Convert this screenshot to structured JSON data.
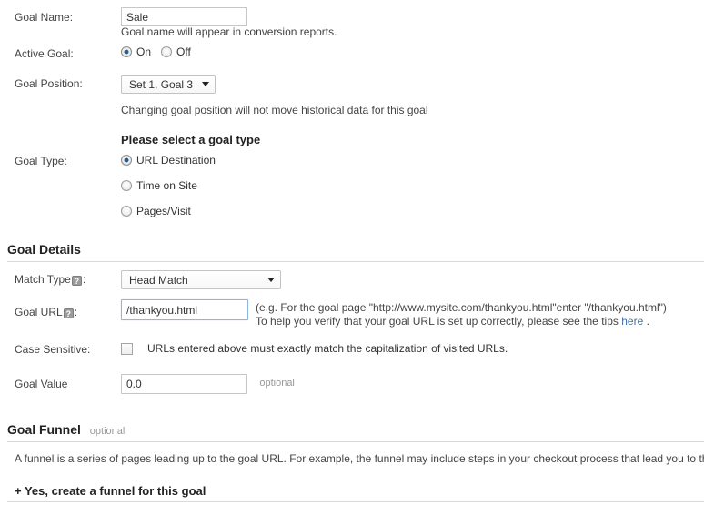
{
  "form": {
    "goal_name": {
      "label": "Goal Name:",
      "value": "Sale",
      "placeholder": "",
      "note": "Goal name will appear in conversion reports."
    },
    "active_goal": {
      "label": "Active Goal:",
      "on_label": "On",
      "off_label": "Off",
      "selected": "On"
    },
    "goal_position": {
      "label": "Goal Position:",
      "value": "Set 1, Goal 3",
      "note": "Changing goal position will not move historical data for this goal"
    },
    "goal_type": {
      "label": "Goal Type:",
      "heading": "Please select a goal type",
      "options": [
        {
          "label": "URL Destination",
          "selected": true
        },
        {
          "label": "Time on Site",
          "selected": false
        },
        {
          "label": "Pages/Visit",
          "selected": false
        }
      ]
    }
  },
  "goal_details": {
    "heading": "Goal Details",
    "match_type": {
      "label_text": "Match Type",
      "label_suffix": ":",
      "help_icon": "question-mark-icon",
      "help_glyph": "?",
      "value": "Head Match"
    },
    "goal_url": {
      "label_text": "Goal URL",
      "label_suffix": ":",
      "help_icon": "question-mark-icon",
      "help_glyph": "?",
      "value": "/thankyou.html",
      "placeholder": "",
      "hint_line1": "(e.g. For the goal page \"http://www.mysite.com/thankyou.html\"enter \"/thankyou.html\")",
      "hint_line2_before": "To help you verify that your goal URL is set up correctly, please see the tips",
      "hint_link": "here",
      "hint_line2_after": "."
    },
    "case_sensitive": {
      "label": "Case Sensitive:",
      "checked": false,
      "description": "URLs entered above must exactly match the capitalization of visited URLs."
    },
    "goal_value": {
      "label": "Goal Value",
      "value": "0.0",
      "placeholder": "",
      "optional_label": "optional"
    }
  },
  "goal_funnel": {
    "heading": "Goal Funnel",
    "optional_label": "optional",
    "description": "A funnel is a series of pages leading up to the goal URL. For example, the funnel may include steps in your checkout process that lead you to the thank you page.",
    "toggle_label": "+ Yes, create a funnel for this goal"
  },
  "colors": {
    "link": "#3d6fa8",
    "radio_dot": "#2a5d8f",
    "focus_border": "#8fb7dd",
    "divider": "#d9d9d9",
    "text": "#444444",
    "muted": "#999999"
  }
}
